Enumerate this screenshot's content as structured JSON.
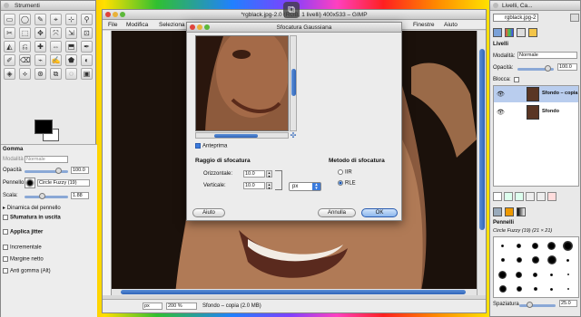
{
  "toolbox": {
    "title": "Strumenti",
    "fg_color": "#000000",
    "bg_color": "#ffffff",
    "tool_options": {
      "header": "Gomma",
      "mode_label": "Modalità",
      "mode_value": "Normale",
      "opacity_label": "Opacità",
      "opacity_value": "100.0",
      "brush_label": "Pennello",
      "brush_value": "Circle Fuzzy (19)",
      "scale_label": "Scala:",
      "scale_value": "1.88",
      "dynamics_label": "Dinamica del pennello",
      "fade_label": "Sfumatura in uscita",
      "jitter_label": "Applica jitter",
      "incremental_label": "Incrementale",
      "hard_edge_label": "Margine netto",
      "anti_erase_label": "Anti gomma  (Alt)"
    }
  },
  "gimp": {
    "title": "*rgblack.jpg-2.0 (RGB, 1 livelli) 400x533 – GIMP",
    "menus": [
      "File",
      "Modifica",
      "Seleziona",
      "Finestre",
      "Aiuto"
    ],
    "status": {
      "unit": "px",
      "zoom": "200 %",
      "layer": "Sfondo – copia (2.0 MB)"
    }
  },
  "dialog": {
    "title": "Sfocatura Gaussiana",
    "preview_label": "Anteprima",
    "radius_header": "Raggio di sfocatura",
    "horizontal_label": "Orizzontale:",
    "horizontal_value": "10.0",
    "vertical_label": "Verticale:",
    "vertical_value": "10.0",
    "unit": "px",
    "method_header": "Metodo di sfocatura",
    "method_iir": "IIR",
    "method_rle": "RLE",
    "help_button": "Aiuto",
    "cancel_button": "Annulla",
    "ok_button": "OK"
  },
  "layers": {
    "title": "Livelli, Ca...",
    "image_select": "rgblack.jpg-2",
    "tab": "Livelli",
    "mode_label": "Modalità:",
    "mode_value": "Normale",
    "opacity_label": "Opacità:",
    "opacity_value": "100.0",
    "lock_label": "Blocca:",
    "items": [
      {
        "name": "Sfondo – copia"
      },
      {
        "name": "Sfondo"
      }
    ],
    "brushes_header": "Pennelli",
    "brush_name": "Circle Fuzzy (19) (21 × 21)",
    "spacing_label": "Spaziatura",
    "spacing_value": "25.0"
  }
}
